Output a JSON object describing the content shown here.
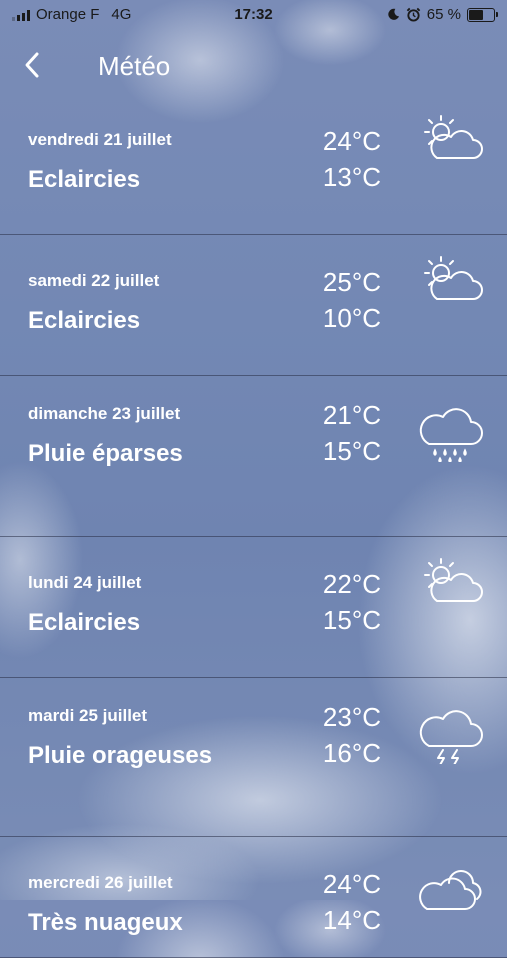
{
  "status_bar": {
    "carrier": "Orange F",
    "network": "4G",
    "time": "17:32",
    "battery_percent": "65 %",
    "battery_level": 0.65
  },
  "nav": {
    "back_icon": "chevron-left-icon",
    "title": "Météo"
  },
  "forecast": [
    {
      "date": "vendredi 21 juillet",
      "condition": "Eclaircies",
      "high": "24°C",
      "low": "13°C",
      "icon": "partly-cloudy-icon"
    },
    {
      "date": "samedi 22 juillet",
      "condition": "Eclaircies",
      "high": "25°C",
      "low": "10°C",
      "icon": "partly-cloudy-icon"
    },
    {
      "date": "dimanche 23 juillet",
      "condition": "Pluie éparses",
      "high": "21°C",
      "low": "15°C",
      "icon": "rain-icon"
    },
    {
      "date": "lundi 24 juillet",
      "condition": "Eclaircies",
      "high": "22°C",
      "low": "15°C",
      "icon": "partly-cloudy-icon"
    },
    {
      "date": "mardi 25 juillet",
      "condition": "Pluie orageuses",
      "high": "23°C",
      "low": "16°C",
      "icon": "thunderstorm-icon"
    },
    {
      "date": "mercredi 26 juillet",
      "condition": "Très nuageux",
      "high": "24°C",
      "low": "14°C",
      "icon": "cloudy-icon"
    }
  ]
}
